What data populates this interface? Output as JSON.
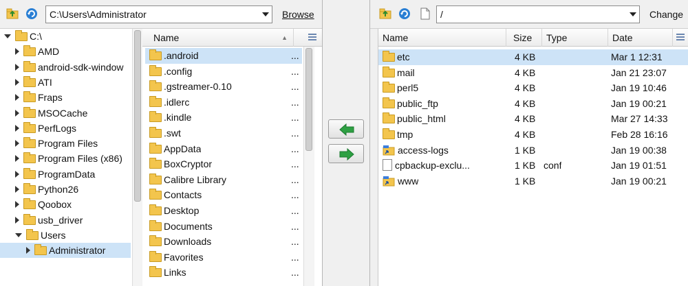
{
  "local": {
    "path": "C:\\Users\\Administrator",
    "browse_label": "Browse",
    "tree": [
      {
        "label": "C:\\",
        "level": 0,
        "state": "open"
      },
      {
        "label": "AMD",
        "level": 1,
        "state": "closed"
      },
      {
        "label": "android-sdk-window",
        "level": 1,
        "state": "closed"
      },
      {
        "label": "ATI",
        "level": 1,
        "state": "closed"
      },
      {
        "label": "Fraps",
        "level": 1,
        "state": "closed"
      },
      {
        "label": "MSOCache",
        "level": 1,
        "state": "closed"
      },
      {
        "label": "PerfLogs",
        "level": 1,
        "state": "closed"
      },
      {
        "label": "Program Files",
        "level": 1,
        "state": "closed"
      },
      {
        "label": "Program Files (x86)",
        "level": 1,
        "state": "closed"
      },
      {
        "label": "ProgramData",
        "level": 1,
        "state": "closed"
      },
      {
        "label": "Python26",
        "level": 1,
        "state": "closed"
      },
      {
        "label": "Qoobox",
        "level": 1,
        "state": "closed"
      },
      {
        "label": "usb_driver",
        "level": 1,
        "state": "closed"
      },
      {
        "label": "Users",
        "level": 1,
        "state": "open"
      },
      {
        "label": "Administrator",
        "level": 2,
        "state": "closed",
        "selected": true
      }
    ],
    "list_header": {
      "name": "Name"
    },
    "files": [
      {
        "name": ".android",
        "more": "...",
        "selected": true
      },
      {
        "name": ".config",
        "more": "..."
      },
      {
        "name": ".gstreamer-0.10",
        "more": "..."
      },
      {
        "name": ".idlerc",
        "more": "..."
      },
      {
        "name": ".kindle",
        "more": "..."
      },
      {
        "name": ".swt",
        "more": "..."
      },
      {
        "name": "AppData",
        "more": "..."
      },
      {
        "name": "BoxCryptor",
        "more": "..."
      },
      {
        "name": "Calibre Library",
        "more": "..."
      },
      {
        "name": "Contacts",
        "more": "..."
      },
      {
        "name": "Desktop",
        "more": "..."
      },
      {
        "name": "Documents",
        "more": "..."
      },
      {
        "name": "Downloads",
        "more": "..."
      },
      {
        "name": "Favorites",
        "more": "..."
      },
      {
        "name": "Links",
        "more": "..."
      }
    ]
  },
  "transfer": {
    "download_icon": "green-arrow-left-icon",
    "upload_icon": "green-arrow-right-icon"
  },
  "remote": {
    "path": "/",
    "change_label": "Change",
    "headers": {
      "name": "Name",
      "size": "Size",
      "type": "Type",
      "date": "Date"
    },
    "files": [
      {
        "name": "etc",
        "size": "4 KB",
        "type": "",
        "date": "Mar 1 12:31",
        "kind": "folder",
        "selected": true
      },
      {
        "name": "mail",
        "size": "4 KB",
        "type": "",
        "date": "Jan 21 23:07",
        "kind": "folder"
      },
      {
        "name": "perl5",
        "size": "4 KB",
        "type": "",
        "date": "Jan 19 10:46",
        "kind": "folder"
      },
      {
        "name": "public_ftp",
        "size": "4 KB",
        "type": "",
        "date": "Jan 19 00:21",
        "kind": "folder"
      },
      {
        "name": "public_html",
        "size": "4 KB",
        "type": "",
        "date": "Mar 27 14:33",
        "kind": "folder"
      },
      {
        "name": "tmp",
        "size": "4 KB",
        "type": "",
        "date": "Feb 28 16:16",
        "kind": "folder"
      },
      {
        "name": "access-logs",
        "size": "1 KB",
        "type": "",
        "date": "Jan 19 00:38",
        "kind": "link"
      },
      {
        "name": "cpbackup-exclu...",
        "size": "1 KB",
        "type": "conf",
        "date": "Jan 19 01:51",
        "kind": "file"
      },
      {
        "name": "www",
        "size": "1 KB",
        "type": "",
        "date": "Jan 19 00:21",
        "kind": "link"
      }
    ]
  },
  "colors": {
    "selection": "#cde3f7",
    "folder": "#f3c54d",
    "arrow": "#2ea043"
  }
}
